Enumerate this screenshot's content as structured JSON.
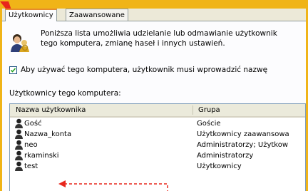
{
  "tabs": [
    {
      "label": "Użytkownicy",
      "active": true
    },
    {
      "label": "Zaawansowane",
      "active": false
    }
  ],
  "info": {
    "line1": "Poniższa lista umożliwia udzielanie lub odmawianie użytkownik",
    "line2": "tego komputera, zmianę haseł i innych ustawień."
  },
  "require_login": {
    "checked": true,
    "label": "Aby używać tego komputera, użytkownik musi wprowadzić nazwę"
  },
  "users_list": {
    "title": "Użytkownicy tego komputera:",
    "columns": [
      "Nazwa użytkownika",
      "Grupa"
    ],
    "rows": [
      {
        "name": "Gość",
        "group": "Goście"
      },
      {
        "name": "Nazwa_konta",
        "group": "Użytkownicy zaawansowa"
      },
      {
        "name": "neo",
        "group": "Administratorzy; Użytkow"
      },
      {
        "name": "rkaminski",
        "group": "Administratorzy"
      },
      {
        "name": "test",
        "group": "Użytkownicy"
      }
    ]
  },
  "colors": {
    "frame": "#f0b418",
    "annotation": "#e8261c",
    "tab_highlight": "#e68b2c"
  },
  "icons": {
    "users_group": "users-group-icon",
    "user": "user-icon"
  }
}
